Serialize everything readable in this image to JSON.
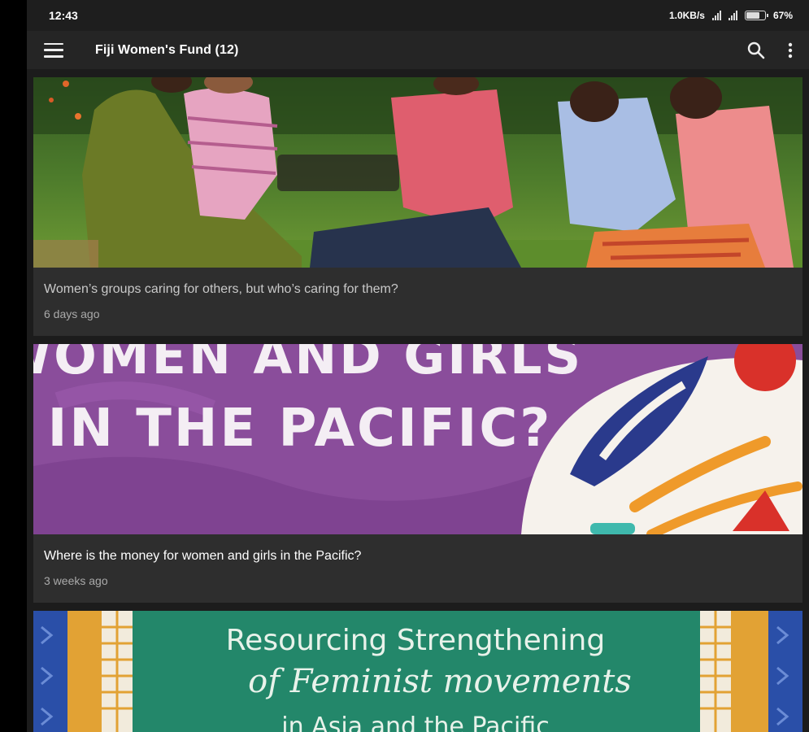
{
  "status_bar": {
    "time": "12:43",
    "network_speed": "1.0KB/s",
    "battery_percent": "67%",
    "battery_level": 0.67
  },
  "app_bar": {
    "title": "Fiji Women's Fund (12)",
    "icons": [
      "menu-icon",
      "search-icon",
      "more-vertical-icon"
    ]
  },
  "feed": {
    "items": [
      {
        "title": "Women’s groups caring for others, but who’s caring for them?",
        "time": "6 days ago",
        "image": "women-sitting-outdoors-photo"
      },
      {
        "title": "Where is the money for women and girls in the Pacific?",
        "time": "3 weeks ago",
        "image": "illustrated-poster",
        "image_text": [
          "WOMEN AND GIRLS",
          "IN THE PACIFIC?"
        ]
      },
      {
        "image": "green-banner",
        "image_text": [
          "Resourcing Strengthening",
          "of Feminist movements",
          "in Asia and the Pacific"
        ]
      }
    ]
  },
  "colors": {
    "background": "#1c1c1c",
    "card": "#2e2e2e",
    "app_bar": "#252525",
    "purple": "#8a4d9b",
    "navy": "#2a3a8c",
    "green": "#23876a"
  }
}
